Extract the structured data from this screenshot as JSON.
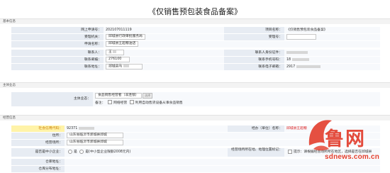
{
  "title": "《仅销售预包装食品备案》",
  "sections": {
    "basic": "基本信息",
    "subject": "主体业态",
    "business": "经营信息"
  },
  "basic": {
    "apply_no_label": "网上申请号：",
    "apply_no": "202107011119",
    "item_name_label": "项目名称：",
    "item_name": "《仅销售预包装食品备案》",
    "dept_label": "受理机关：",
    "dept": "邱城县行政审批服务局",
    "accept_no_label": "受理号：",
    "applicant_label": "申请名称：",
    "applicant": "邱城县王超粮油店",
    "contact_label": "联系人：",
    "contact": "王",
    "contact_id_label": "联系人身份证件：",
    "email_label": "联系邮编：",
    "email": "276100",
    "phone_label": "联系手机号码：",
    "phone": "18",
    "address_label": "联系地址：",
    "address": "郯城县马",
    "mail_label": "联系电子邮箱：",
    "mail": "2917"
  },
  "subject": {
    "label": "主体业态：",
    "type": "食品销售经营者（非连锁）",
    "select_btn": "选择",
    "note_label": "备注：",
    "opt1": "网络经营",
    "opt2": "利用自动售货设备从事食品销售"
  },
  "business": {
    "credit_label": "社会信用代码：",
    "credit": "92371",
    "operator_label": "经办（单位）名称：",
    "operator": "邱城县王超粮",
    "residence_label": "住所：",
    "residence": "山东省临沂市郯城县郯城",
    "site_label": "经营场所：",
    "site": "山东省临沂市郯城县郯城",
    "sme_label": "是否是中小企业：",
    "sme_yes": "是",
    "sme_no": "是(中小型企业限额2008元内)",
    "area_label": "经营场所所在地、地理位置标记：",
    "area_note": "提示：请根据经营场所所在地区，选择是否在邱城县",
    "storage_label": "仓库地址：",
    "storage2_label": "仓库分布地址："
  },
  "watermark": {
    "brand": "鲁网",
    "site": "sdnews.com.cn",
    "color": "#e23d2c"
  }
}
